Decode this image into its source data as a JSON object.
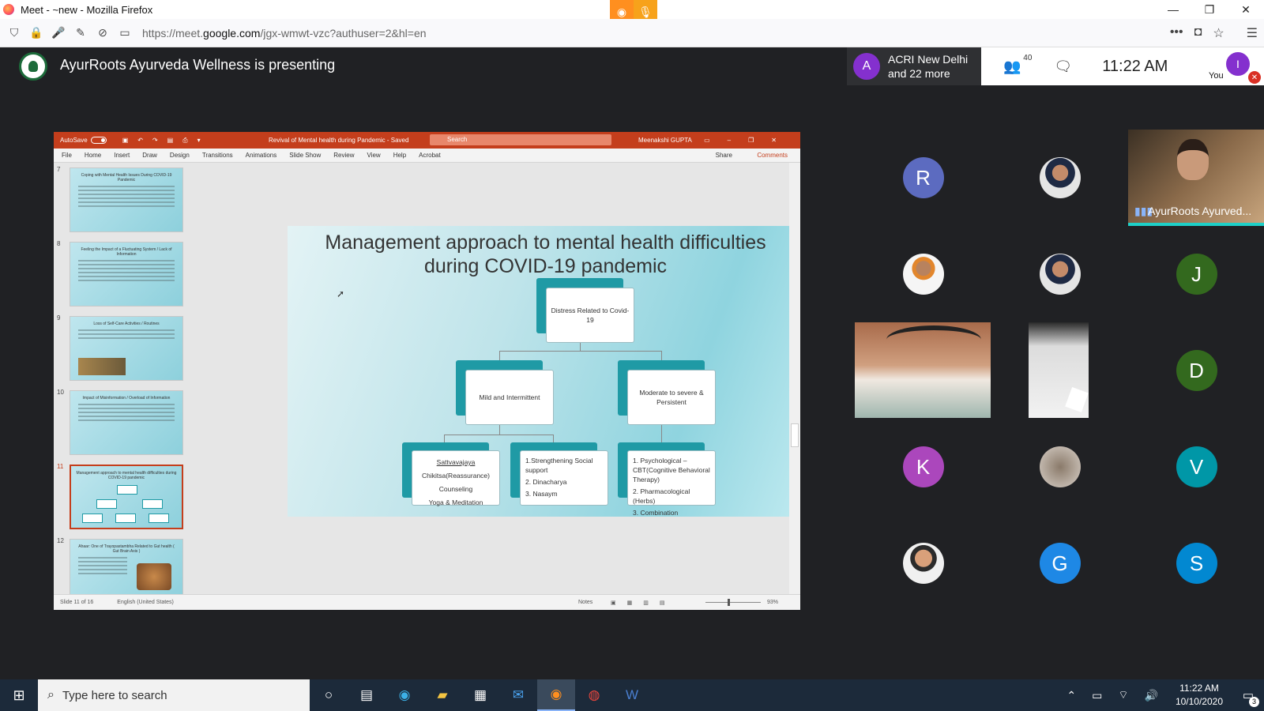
{
  "firefox": {
    "window_title": "Meet - ~new - Mozilla Firefox",
    "url_prefix": "https://meet.",
    "url_domain": "google.com",
    "url_path": "/jgx-wmwt-vzc?authuser=2&hl=en"
  },
  "meet": {
    "presenting_text": "AyurRoots Ayurveda Wellness is presenting",
    "people_avatar_letter": "A",
    "people_line1": "ACRI New Delhi",
    "people_line2": "and 22 more",
    "participant_count": "40",
    "time": "11:22 AM",
    "you_label": "You",
    "you_avatar_letter": "I"
  },
  "powerpoint": {
    "autosave_label": "AutoSave",
    "toggle_label": "On",
    "doc_title": "Revival of Mental health during Pandemic - Saved",
    "search_placeholder": "Search",
    "user_name": "Meenakshi GUPTA",
    "user_initials": "MG",
    "menu": [
      "File",
      "Home",
      "Insert",
      "Draw",
      "Design",
      "Transitions",
      "Animations",
      "Slide Show",
      "Review",
      "View",
      "Help",
      "Acrobat"
    ],
    "share_label": "Share",
    "comments_label": "Comments",
    "thumbnails": [
      {
        "num": "7",
        "title": "Coping with Mental Health Issues During COVID-19 Pandemic"
      },
      {
        "num": "8",
        "title": "Feeling the Impact of a Fluctuating System / Lack of Information"
      },
      {
        "num": "9",
        "title": "Loss of Self-Care Activities / Routines"
      },
      {
        "num": "10",
        "title": "Impact of Misinformation / Overload of Information"
      },
      {
        "num": "11",
        "title": "Management approach to mental health difficulties during COVID-19 pandemic"
      },
      {
        "num": "12",
        "title": "Ahaar: One of Trayopastambha Related to Gut health ( Gut Brain Axis )"
      }
    ],
    "status_slide": "Slide 11 of 16",
    "status_language": "English (United States)",
    "notes_label": "Notes",
    "zoom": "93%"
  },
  "slide": {
    "title_line1": "Management approach to mental health difficulties",
    "title_line2": "during COVID-19 pandemic",
    "root": "Distress Related to Covid-19",
    "left_branch": "Mild and Intermittent",
    "right_branch": "Moderate to severe & Persistent",
    "leaf1": [
      "Sattvavajaya",
      "Chikitsa(Reassurance)",
      "Counseling",
      "Yoga & Meditation"
    ],
    "leaf2": [
      "1.Strengthening Social support",
      "2.  Dinacharya",
      "3.   Nasaym"
    ],
    "leaf3": [
      "1.  Psychological – CBT(Cognitive Behavioral Therapy)",
      "2.  Pharmacological (Herbs)",
      "3.  Combination"
    ]
  },
  "participants": {
    "speaker_name": "AyurRoots Ayurved...",
    "letters": {
      "r": "R",
      "j": "J",
      "d": "D",
      "k": "K",
      "v": "V",
      "g": "G",
      "s": "S"
    },
    "colors": {
      "r": "#5c6bc0",
      "j": "#33691e",
      "d": "#33691e",
      "k": "#ab47bc",
      "v": "#0097a7",
      "g": "#1e88e5",
      "s": "#0288d1"
    }
  },
  "taskbar": {
    "search_placeholder": "Type here to search",
    "clock_time": "11:22 AM",
    "clock_date": "10/10/2020",
    "notification_count": "3"
  }
}
